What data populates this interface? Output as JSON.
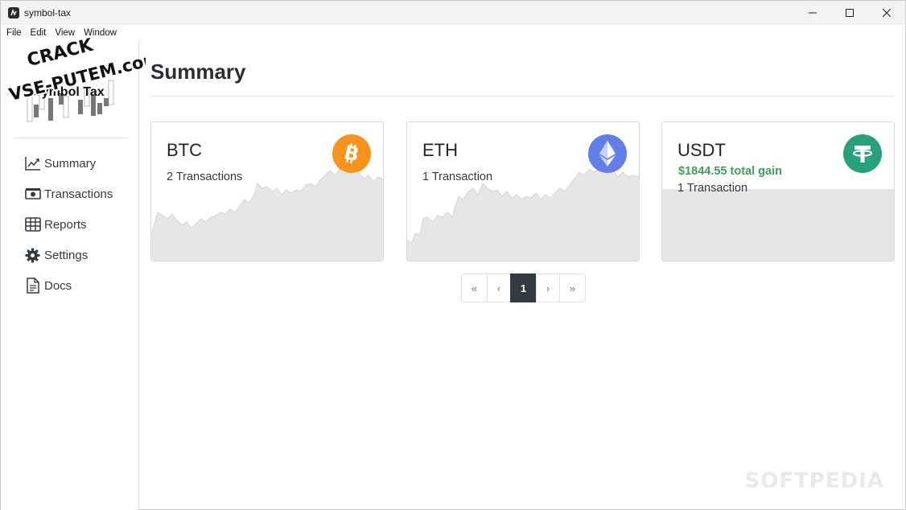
{
  "window": {
    "title": "symbol-tax"
  },
  "menubar": {
    "items": [
      "File",
      "Edit",
      "View",
      "Window"
    ]
  },
  "watermark": {
    "crack_line1": "CRACK",
    "crack_line2": "VSE-PUTEM.com",
    "softpedia": "SOFTPEDIA"
  },
  "brand": {
    "title": "Symbol Tax"
  },
  "nav": [
    {
      "label": "Summary",
      "icon": "chart-line-icon"
    },
    {
      "label": "Transactions",
      "icon": "cash-icon"
    },
    {
      "label": "Reports",
      "icon": "table-icon"
    },
    {
      "label": "Settings",
      "icon": "gear-icon"
    },
    {
      "label": "Docs",
      "icon": "document-icon"
    }
  ],
  "page": {
    "title": "Summary"
  },
  "cards": [
    {
      "symbol": "BTC",
      "gain": "",
      "transactions": "2 Transactions",
      "icon": "bitcoin-icon",
      "icon_color": "#f7931a"
    },
    {
      "symbol": "ETH",
      "gain": "",
      "transactions": "1 Transaction",
      "icon": "ethereum-icon",
      "icon_color": "#627eea"
    },
    {
      "symbol": "USDT",
      "gain": "$1844.55 total gain",
      "transactions": "1 Transaction",
      "icon": "tether-icon",
      "icon_color": "#26a17b"
    }
  ],
  "pagination": {
    "first": "«",
    "prev": "‹",
    "current": "1",
    "next": "›",
    "last": "»"
  },
  "colors": {
    "gain": "#3aa357",
    "sparkline_fill": "#e6e6e6",
    "active_page": "#343a40"
  }
}
